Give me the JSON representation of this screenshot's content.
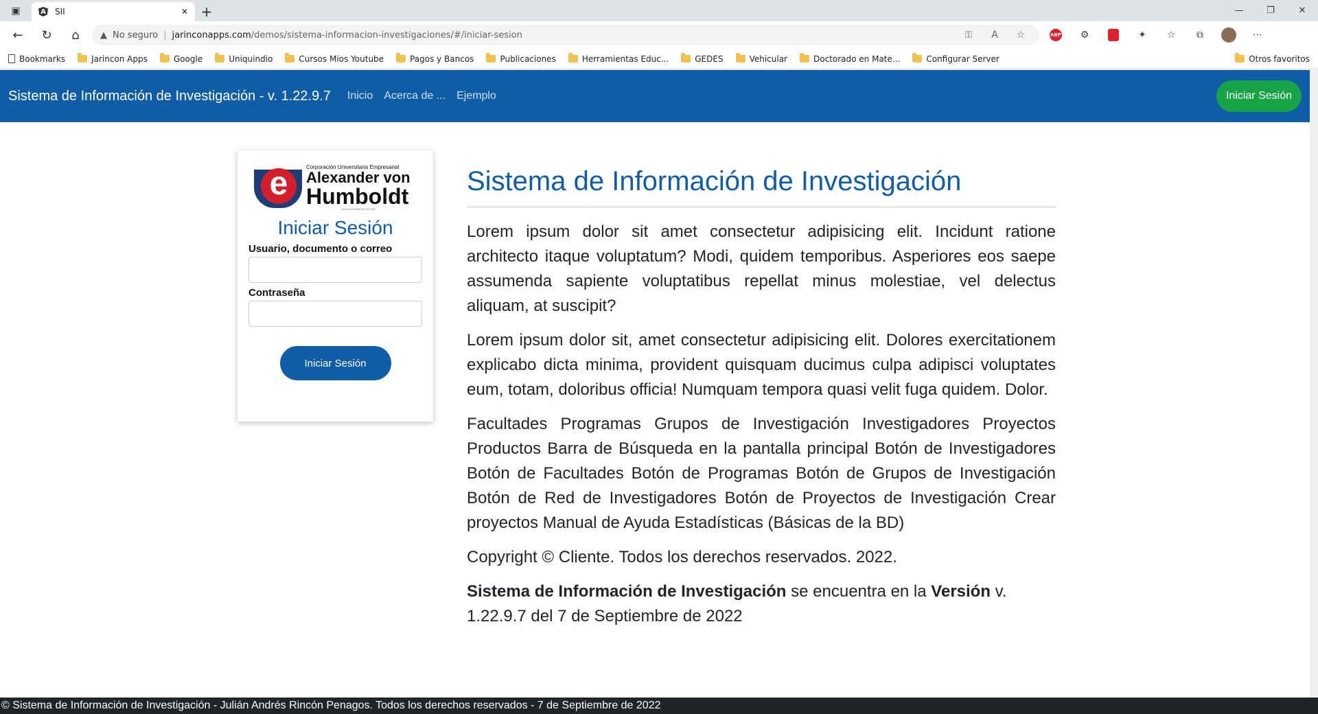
{
  "browser": {
    "tab_title": "SII",
    "favicon_letter": "A",
    "security_label": "No seguro",
    "url_host": "jarinconapps.com",
    "url_path": "/demos/sistema-informacion-investigaciones/#/iniciar-sesion",
    "bookmarks": [
      "Bookmarks",
      "Jarincon Apps",
      "Google",
      "Uniquindio",
      "Cursos Mios Youtube",
      "Pagos y Bancos",
      "Publicaciones",
      "Herramientas Educ...",
      "GEDES",
      "Vehicular",
      "Doctorado en Mate...",
      "Configurar Server"
    ],
    "other_bookmarks": "Otros favoritos",
    "abp_label": "ABP"
  },
  "navbar": {
    "brand": "Sistema de Información de Investigación - v. 1.22.9.7",
    "links": [
      "Inicio",
      "Acerca de ...",
      "Ejemplo"
    ],
    "login_button": "Iniciar Sesión"
  },
  "login_card": {
    "logo": {
      "line1": "Corporación Universitaria Empresarial",
      "line2": "Alexander von",
      "line3": "Humboldt",
      "line4": "VIGILADA MINEDUCACIÓN",
      "letter": "e"
    },
    "title": "Iniciar Sesión",
    "user_label": "Usuario, documento o correo",
    "user_value": "",
    "password_label": "Contraseña",
    "password_value": "",
    "submit_label": "Iniciar Sesión"
  },
  "main": {
    "heading": "Sistema de Información de Investigación",
    "paragraph1": "Lorem ipsum dolor sit amet consectetur adipisicing elit. Incidunt ratione architecto itaque voluptatum? Modi, quidem temporibus. Asperiores eos saepe assumenda sapiente voluptatibus repellat minus molestiae, vel delectus aliquam, at suscipit?",
    "paragraph2": "Lorem ipsum dolor sit, amet consectetur adipisicing elit. Dolores exercitationem explicabo dicta minima, provident quisquam ducimus culpa adipisci voluptates eum, totam, doloribus officia! Numquam tempora quasi velit fuga quidem. Dolor.",
    "paragraph3": "Facultades Programas Grupos de Investigación Investigadores Proyectos Productos Barra de Búsqueda en la pantalla principal Botón de Investigadores Botón de Facultades Botón de Programas Botón de Grupos de Investigación Botón de Red de Investigadores Botón de Proyectos de Investigación Crear proyectos Manual de Ayuda Estadísticas (Básicas de la BD)",
    "copyright": "Copyright © Cliente. Todos los derechos reservados. 2022.",
    "version_name": "Sistema de Información de Investigación",
    "version_mid": " se encuentra en la ",
    "version_word": "Versión",
    "version_rest": " v. 1.22.9.7 del 7 de Septiembre de 2022"
  },
  "footer": {
    "text": "© Sistema de Información de Investigación - Julián Andrés Rincón Penagos. Todos los derechos reservados - 7 de Septiembre de 2022"
  },
  "colors": {
    "primary": "#0f5da6",
    "success": "#18a346",
    "footer_bg": "#212529"
  }
}
